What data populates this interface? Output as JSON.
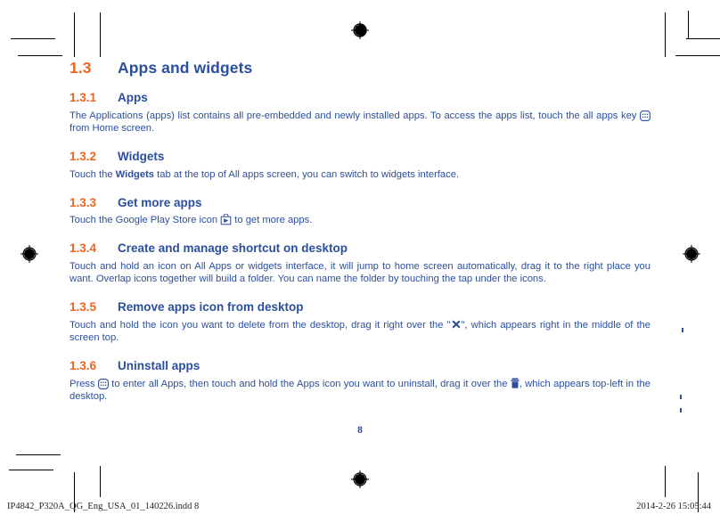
{
  "document": {
    "page_number": "8",
    "footer_left": "IP4842_P320A_QG_Eng_USA_01_140226.indd   8",
    "footer_right": "2014-2-26   15:05:44"
  },
  "colors": {
    "heading_blue": "#2b4f9e",
    "number_orange": "#f06321",
    "body_blue": "#2b4f9e",
    "footer_black": "#231f20"
  },
  "sections": {
    "main": {
      "number": "1.3",
      "title": "Apps and widgets"
    },
    "apps": {
      "number": "1.3.1",
      "title": "Apps",
      "text_before_icon": "The Applications (apps) list contains all pre-embedded and newly installed apps. To access the apps list, touch the all apps key ",
      "text_after_icon": " from Home screen."
    },
    "widgets": {
      "number": "1.3.2",
      "title": "Widgets",
      "text_1": "Touch the ",
      "text_bold": "Widgets",
      "text_2": " tab at the top of All apps screen, you can switch to widgets interface."
    },
    "get_more_apps": {
      "number": "1.3.3",
      "title": "Get more apps",
      "text_before_icon": "Touch the Google Play Store icon ",
      "text_after_icon": " to get more apps."
    },
    "create_shortcut": {
      "number": "1.3.4",
      "title": "Create and manage shortcut on desktop",
      "text": "Touch and hold an icon on All Apps or widgets interface, it will jump to home screen automatically, drag it to the right place you want. Overlap icons together will build a folder. You can name the folder by touching the tap under the icons."
    },
    "remove_apps": {
      "number": "1.3.5",
      "title": "Remove apps icon from desktop",
      "text_before_icon": "Touch and hold the icon you want to delete from the desktop, drag it right over the \"",
      "text_after_icon": "\", which appears right in the middle of the screen top."
    },
    "uninstall": {
      "number": "1.3.6",
      "title": "Uninstall apps",
      "text_before_icon1": "Press ",
      "text_middle": " to enter all Apps, then touch and hold the Apps icon you want to uninstall, drag it over the ",
      "text_after_icon2": ", which appears top-left in the desktop."
    }
  },
  "icons": {
    "all_apps_key": "all-apps-key-icon",
    "play_store": "play-store-icon",
    "remove_x": "remove-x-icon",
    "trash": "trash-icon",
    "registration_mark": "registration-mark-icon"
  }
}
